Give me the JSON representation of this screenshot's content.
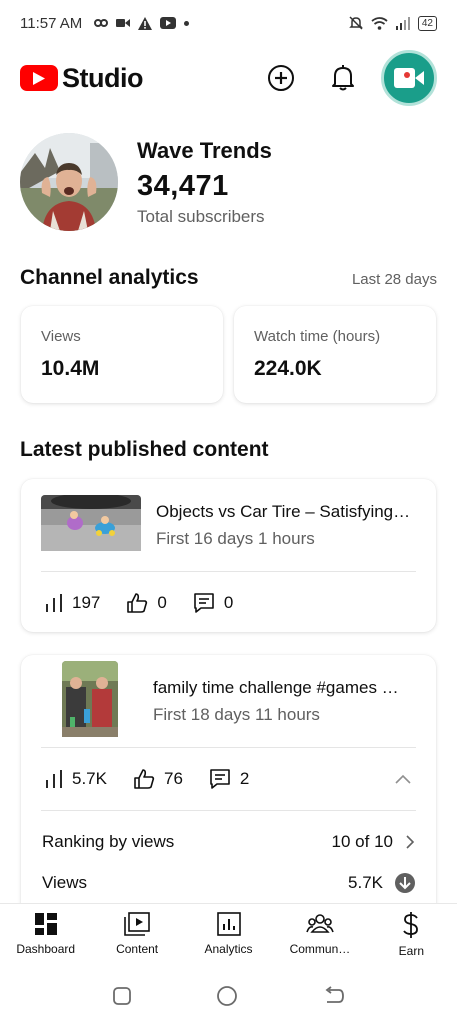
{
  "status_bar": {
    "time": "11:57 AM",
    "battery": "42"
  },
  "header": {
    "app_name": "Studio"
  },
  "channel": {
    "name": "Wave Trends",
    "subscribers": "34,471",
    "subscribers_label": "Total subscribers"
  },
  "analytics": {
    "title": "Channel analytics",
    "period": "Last 28 days",
    "views_label": "Views",
    "views_value": "10.4M",
    "watch_label": "Watch time (hours)",
    "watch_value": "224.0K"
  },
  "latest": {
    "title": "Latest published content",
    "videos": [
      {
        "title": "Objects vs Car Tire – Satisfying…",
        "age": "First 16 days 1 hours",
        "views": "197",
        "likes": "0",
        "comments": "0"
      },
      {
        "title": "family time challenge #games …",
        "age": "First 18 days 11 hours",
        "views": "5.7K",
        "likes": "76",
        "comments": "2",
        "ranking_label": "Ranking by views",
        "ranking_value": "10 of 10",
        "views_label": "Views",
        "views_value": "5.7K"
      }
    ]
  },
  "nav": {
    "items": [
      {
        "label": "Dashboard",
        "icon": "dashboard-icon"
      },
      {
        "label": "Content",
        "icon": "content-icon"
      },
      {
        "label": "Analytics",
        "icon": "analytics-icon"
      },
      {
        "label": "Commun…",
        "icon": "community-icon"
      },
      {
        "label": "Earn",
        "icon": "earn-icon"
      }
    ]
  },
  "colors": {
    "brand_red": "#ff0000",
    "camera_green": "#1a9e8a",
    "secondary_text": "#606060"
  }
}
